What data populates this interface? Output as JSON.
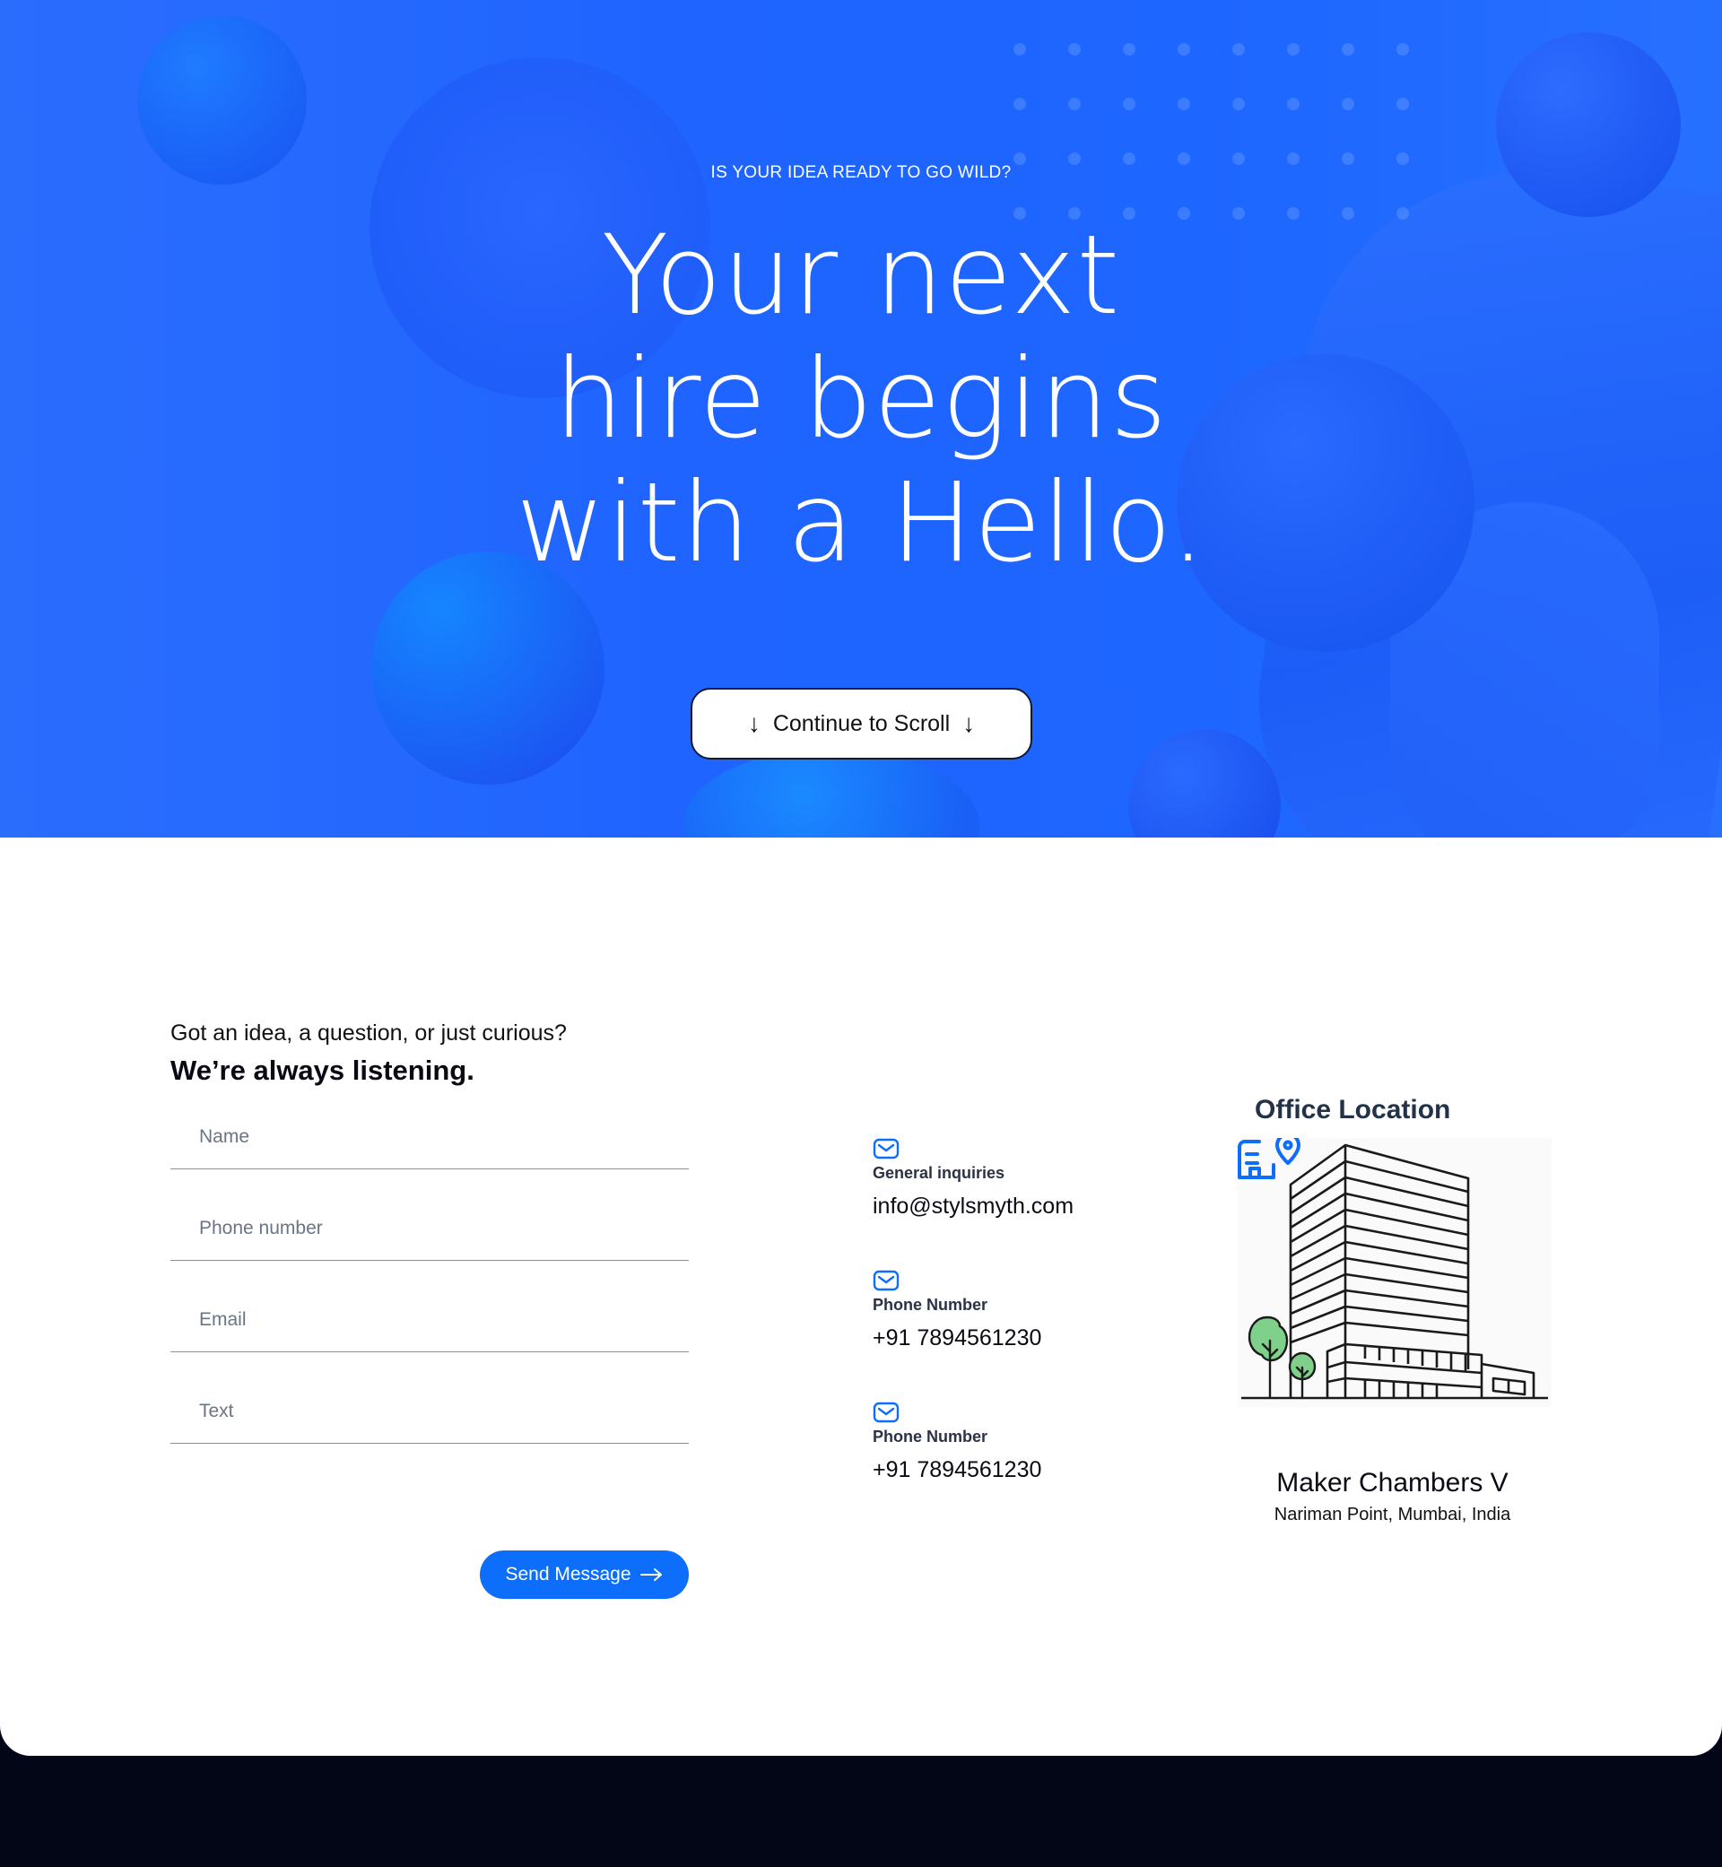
{
  "hero": {
    "eyebrow": "IS YOUR IDEA READY TO GO WILD?",
    "headline_lines": [
      "Your next",
      "hire begins",
      "with a Hello."
    ],
    "scroll_button_label": "Continue to Scroll"
  },
  "contact": {
    "intro_line1": "Got an idea, a question, or just curious?",
    "intro_line2": "We’re always listening.",
    "form": {
      "fields": [
        {
          "placeholder": "Name",
          "value": ""
        },
        {
          "placeholder": "Phone number",
          "value": ""
        },
        {
          "placeholder": "Email",
          "value": ""
        },
        {
          "placeholder": "Text",
          "value": ""
        }
      ],
      "submit_label": "Send Message"
    },
    "info": [
      {
        "icon": "mail-icon",
        "label": "General inquiries",
        "value": "info@stylsmyth.com"
      },
      {
        "icon": "mail-icon",
        "label": "Phone Number",
        "value": "+91 7894561230"
      },
      {
        "icon": "mail-icon",
        "label": "Phone Number",
        "value": "+91 7894561230"
      }
    ],
    "office": {
      "title": "Office Location",
      "name": "Maker Chambers V",
      "address": "Nariman Point, Mumbai, India"
    }
  },
  "colors": {
    "hero_blue": "#1f64ff",
    "accent_blue": "#0e6efc",
    "footer_dark": "#030617",
    "tree_green": "#7ed08a"
  }
}
